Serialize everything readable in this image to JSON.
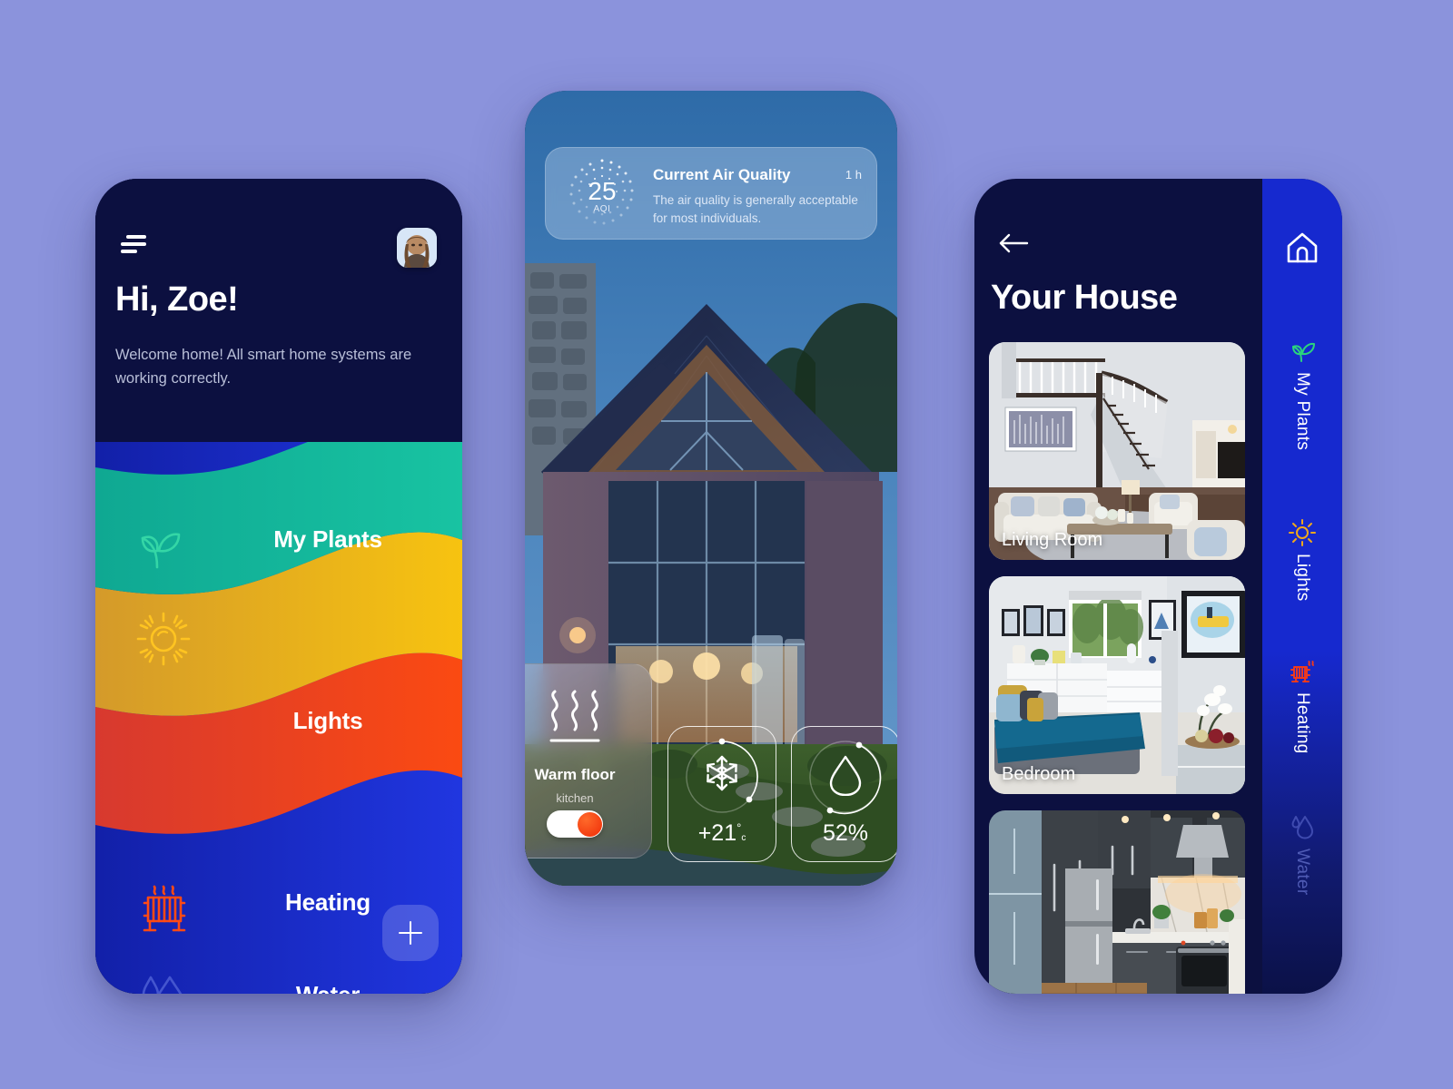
{
  "theme": {
    "page_bg": "#8b93dc",
    "dark_navy": "#0c1040",
    "accent_blue": "#1629cf",
    "teal": "#14b89b",
    "amber": "#e9a91f",
    "red": "#ee3b24",
    "blue": "#1a2bc8",
    "toggle_on": "#ef2b07"
  },
  "phone1": {
    "menu_icon": "hamburger-icon",
    "avatar_icon": "user-avatar",
    "greeting": "Hi, Zoe!",
    "welcome": "Welcome home! All smart home systems are working correctly.",
    "fab_label": "+",
    "fab_icon": "plus-icon",
    "menu": [
      {
        "label": "My Plants",
        "icon": "plant-sprout-icon",
        "color": "#14b89b"
      },
      {
        "label": "Lights",
        "icon": "sun-icon",
        "color": "#e9a91f"
      },
      {
        "label": "Heating",
        "icon": "radiator-icon",
        "color": "#ee3b24"
      },
      {
        "label": "Water",
        "icon": "water-drop-icon",
        "color": "#1a2bc8"
      }
    ]
  },
  "phone2": {
    "air_quality": {
      "value": "25",
      "unit": "AQI",
      "title": "Current Air Quality",
      "time": "1 h",
      "description": "The air quality is generally acceptable for most individuals.",
      "gauge_icon": "dotted-ring-gauge"
    },
    "warm_floor": {
      "icon": "heat-waves-icon",
      "title": "Warm floor",
      "subtitle": "kitchen",
      "toggle_state": "on"
    },
    "sensors": [
      {
        "name": "temperature",
        "icon": "snowflake-icon",
        "value": "+21",
        "degree": "°",
        "unit": "c",
        "progress": 72
      },
      {
        "name": "humidity",
        "icon": "water-drop-icon",
        "value": "52%",
        "degree": "",
        "unit": "",
        "progress": 52
      }
    ]
  },
  "phone3": {
    "back_icon": "arrow-left-icon",
    "title": "Your House",
    "rooms": [
      {
        "label": "Living Room",
        "image": "living-room-photo"
      },
      {
        "label": "Bedroom",
        "image": "bedroom-photo"
      },
      {
        "label": "",
        "image": "kitchen-photo"
      }
    ],
    "rail": {
      "home_icon": "home-icon",
      "items": [
        {
          "label": "My Plants",
          "icon": "plant-sprout-icon",
          "color": "#2bd47d"
        },
        {
          "label": "Lights",
          "icon": "sun-icon",
          "color": "#f0a81c"
        },
        {
          "label": "Heating",
          "icon": "radiator-icon",
          "color": "#f23a1b"
        },
        {
          "label": "Water",
          "icon": "water-drop-icon",
          "color": "#3f4bb0"
        }
      ]
    }
  }
}
